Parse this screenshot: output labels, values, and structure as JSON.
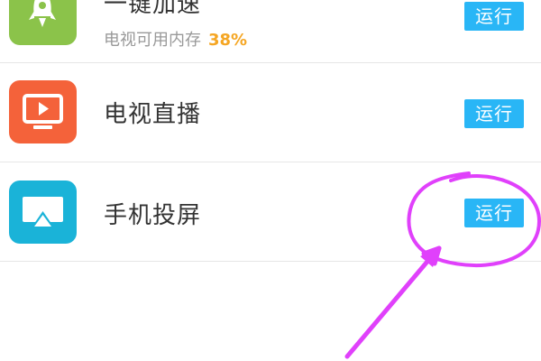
{
  "apps": [
    {
      "name": "一键加速",
      "memory_label": "电视可用内存",
      "memory_value": "38%",
      "run_label": "运行",
      "icon": "rocket-icon",
      "icon_color": "#8bc34a"
    },
    {
      "name": "电视直播",
      "run_label": "运行",
      "icon": "tv-play-icon",
      "icon_color": "#f4623a"
    },
    {
      "name": "手机投屏",
      "run_label": "运行",
      "icon": "airplay-icon",
      "icon_color": "#1ab3d8"
    }
  ],
  "colors": {
    "run_button": "#29b6f6",
    "annotation": "#e040fb",
    "highlight_percent": "#f5a623"
  }
}
